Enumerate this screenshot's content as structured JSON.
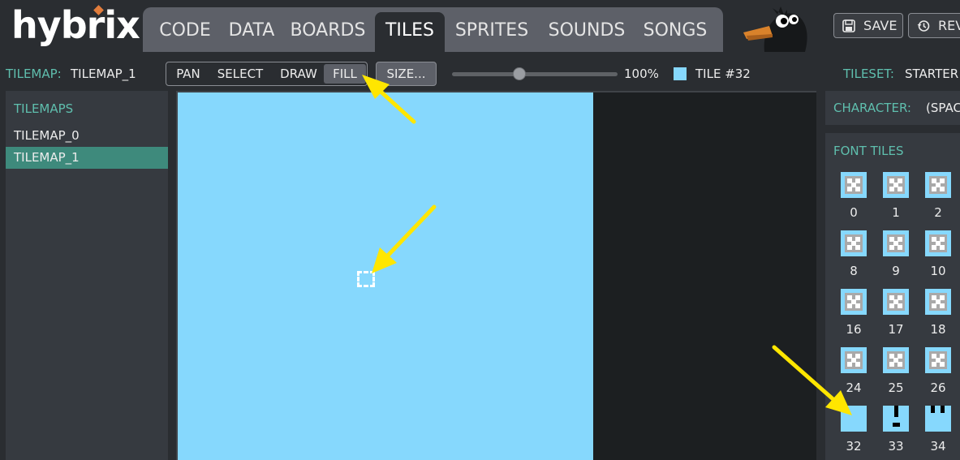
{
  "app": {
    "logo": "hybrix"
  },
  "tabs": [
    {
      "label": "CODE"
    },
    {
      "label": "DATA"
    },
    {
      "label": "BOARDS"
    },
    {
      "label": "TILES"
    },
    {
      "label": "SPRITES"
    },
    {
      "label": "SOUNDS"
    },
    {
      "label": "SONGS"
    }
  ],
  "active_tab": "TILES",
  "top_buttons": {
    "save": "SAVE",
    "revert": "REV"
  },
  "toolbar": {
    "tilemap_label": "TILEMAP:",
    "tilemap_value": "TILEMAP_1",
    "modes": [
      "PAN",
      "SELECT",
      "DRAW",
      "FILL"
    ],
    "active_mode": "FILL",
    "size_button": "SIZE...",
    "zoom": "100%",
    "zoom_fraction": 0.4,
    "tile_label": "TILE #32",
    "tileset_label": "TILESET:",
    "tileset_value": "STARTER"
  },
  "left_panel": {
    "title": "TILEMAPS",
    "items": [
      {
        "label": "TILEMAP_0",
        "selected": false
      },
      {
        "label": "TILEMAP_1",
        "selected": true
      }
    ]
  },
  "right_panel": {
    "character_label": "CHARACTER:",
    "character_value": "(SPAC",
    "font_tiles_title": "FONT TILES",
    "tiles": [
      "0",
      "1",
      "2",
      "8",
      "9",
      "10",
      "16",
      "17",
      "18",
      "24",
      "25",
      "26",
      "32",
      "33",
      "34"
    ]
  },
  "colors": {
    "accent_teal": "#5fbfae",
    "selected_row": "#3e8a7c",
    "tile_fill": "#86d8fd",
    "annotation_arrow": "#ffe600",
    "logo_accent": "#e27d3c"
  }
}
